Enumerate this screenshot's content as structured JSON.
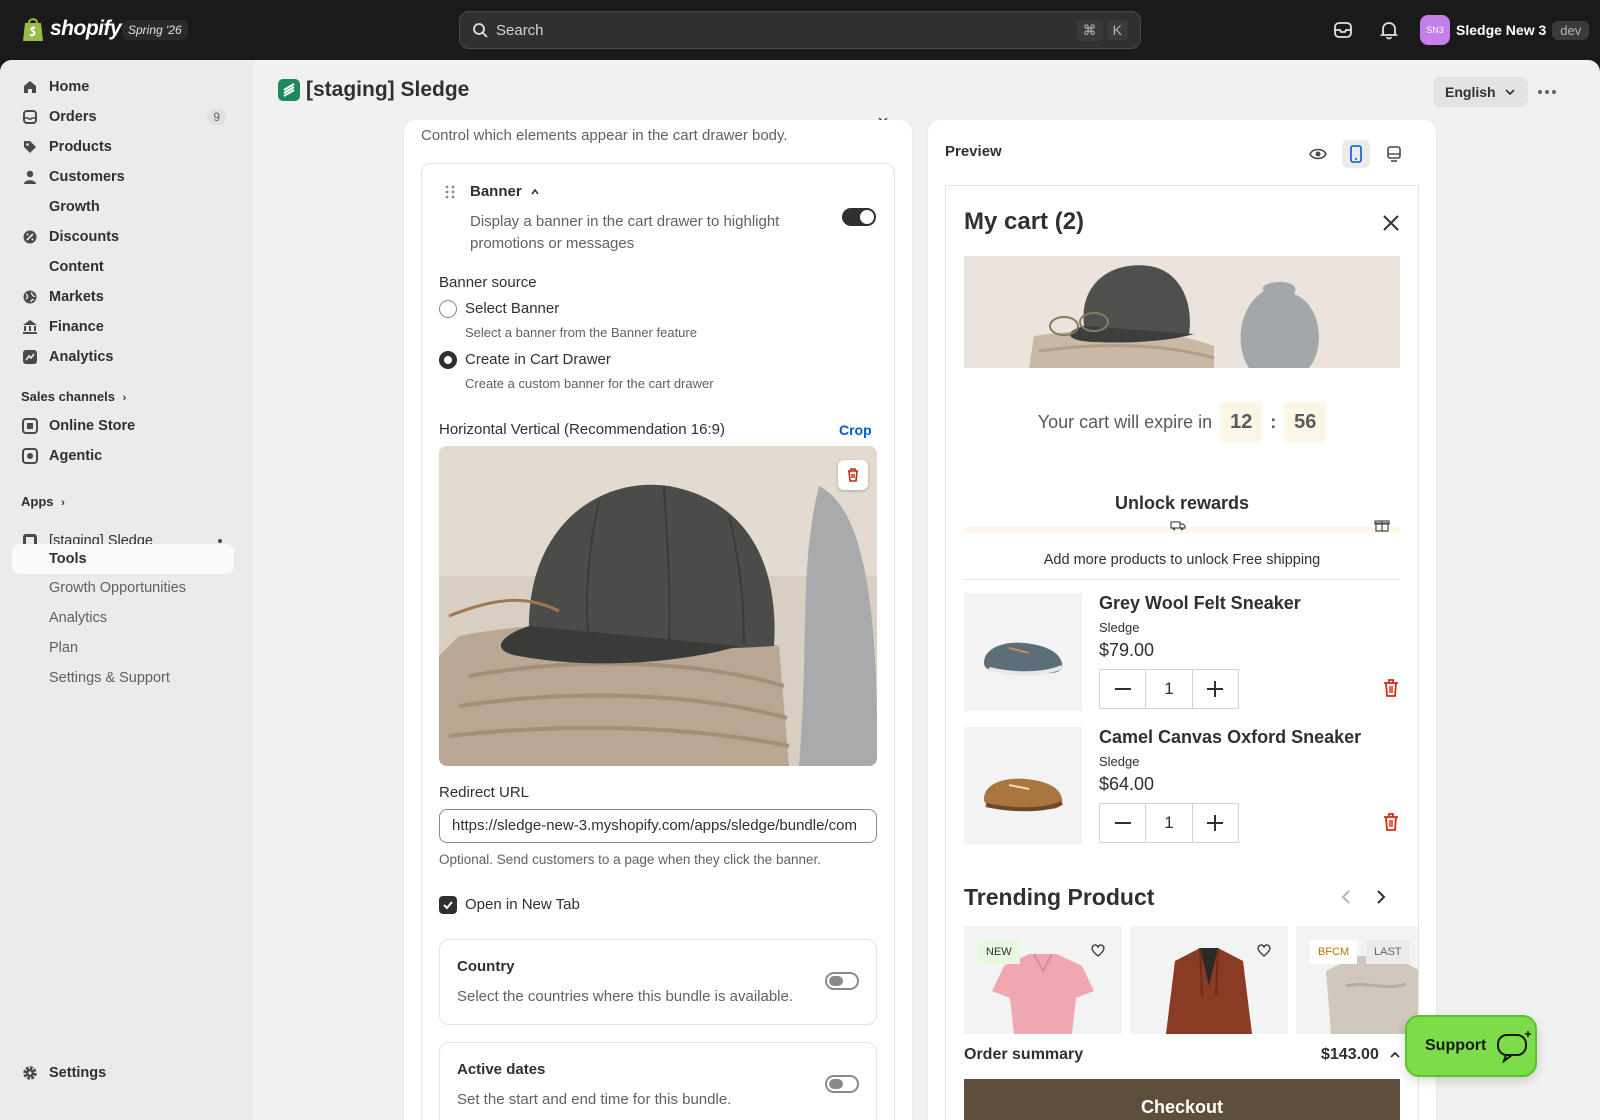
{
  "topbar": {
    "brand": "shopify",
    "edition_badge": "Spring '26",
    "search_placeholder": "Search",
    "shortcut_cmd": "⌘",
    "shortcut_key": "K",
    "account_initials": "SN3",
    "account_name": "Sledge New 3",
    "env_badge": "dev"
  },
  "sidebar": {
    "items": [
      {
        "label": "Home",
        "icon": "home-icon"
      },
      {
        "label": "Orders",
        "icon": "orders-icon",
        "count": "9"
      },
      {
        "label": "Products",
        "icon": "tag-icon"
      },
      {
        "label": "Customers",
        "icon": "person-icon"
      },
      {
        "label": "Growth",
        "icon": "growth-icon"
      },
      {
        "label": "Discounts",
        "icon": "discount-icon"
      },
      {
        "label": "Content",
        "icon": "content-icon"
      },
      {
        "label": "Markets",
        "icon": "globe-icon"
      },
      {
        "label": "Finance",
        "icon": "bank-icon"
      },
      {
        "label": "Analytics",
        "icon": "chart-icon"
      }
    ],
    "sales_channels_label": "Sales channels",
    "channels": [
      {
        "label": "Online Store",
        "icon": "store-icon"
      },
      {
        "label": "Agentic",
        "icon": "agentic-icon"
      }
    ],
    "apps_label": "Apps",
    "app": {
      "label": "[staging] Sledge",
      "icon": "sledge-app-icon"
    },
    "app_sub": [
      "Tools",
      "Growth Opportunities",
      "Analytics",
      "Plan",
      "Settings & Support"
    ],
    "settings_label": "Settings"
  },
  "header": {
    "title": "[staging] Sledge",
    "language": "English"
  },
  "editor": {
    "description": "Control which elements appear in the cart drawer body.",
    "banner_title": "Banner",
    "banner_desc": "Display a banner in the cart drawer to highlight promotions or messages",
    "source_label": "Banner source",
    "option1_label": "Select Banner",
    "option1_help": "Select a banner from the Banner feature",
    "option2_label": "Create in Cart Drawer",
    "option2_help": "Create a custom banner for the cart drawer",
    "image_label": "Horizontal Vertical (Recommendation 16:9)",
    "crop_label": "Crop",
    "url_label": "Redirect URL",
    "url_value": "https://sledge-new-3.myshopify.com/apps/sledge/bundle/com",
    "url_help": "Optional. Send customers to a page when they click the banner.",
    "newtab_label": "Open in New Tab",
    "country_title": "Country",
    "country_desc": "Select the countries where this bundle is available.",
    "dates_title": "Active dates",
    "dates_desc": "Set the start and end time for this bundle."
  },
  "preview": {
    "title": "Preview",
    "cart_title": "My cart (2)",
    "expire_text": "Your cart will expire in",
    "minutes": "12",
    "colon": ":",
    "seconds": "56",
    "unlock_title": "Unlock rewards",
    "unlock_text": "Add more products to unlock Free shipping",
    "items": [
      {
        "name": "Grey Wool Felt Sneaker",
        "vendor": "Sledge",
        "price": "$79.00",
        "qty": "1"
      },
      {
        "name": "Camel Canvas Oxford Sneaker",
        "vendor": "Sledge",
        "price": "$64.00",
        "qty": "1"
      }
    ],
    "trending_title": "Trending Product",
    "badges": [
      "NEW",
      "BFCM",
      "LAST"
    ],
    "order_summary_label": "Order summary",
    "order_total": "$143.00",
    "checkout_label": "Checkout"
  },
  "support_label": "Support",
  "colors": {
    "accent_link": "#005bd3",
    "support_green": "#7ddc4a",
    "checkout_brown": "#5d4f3c",
    "avatar_purple": "#c67ee8"
  }
}
